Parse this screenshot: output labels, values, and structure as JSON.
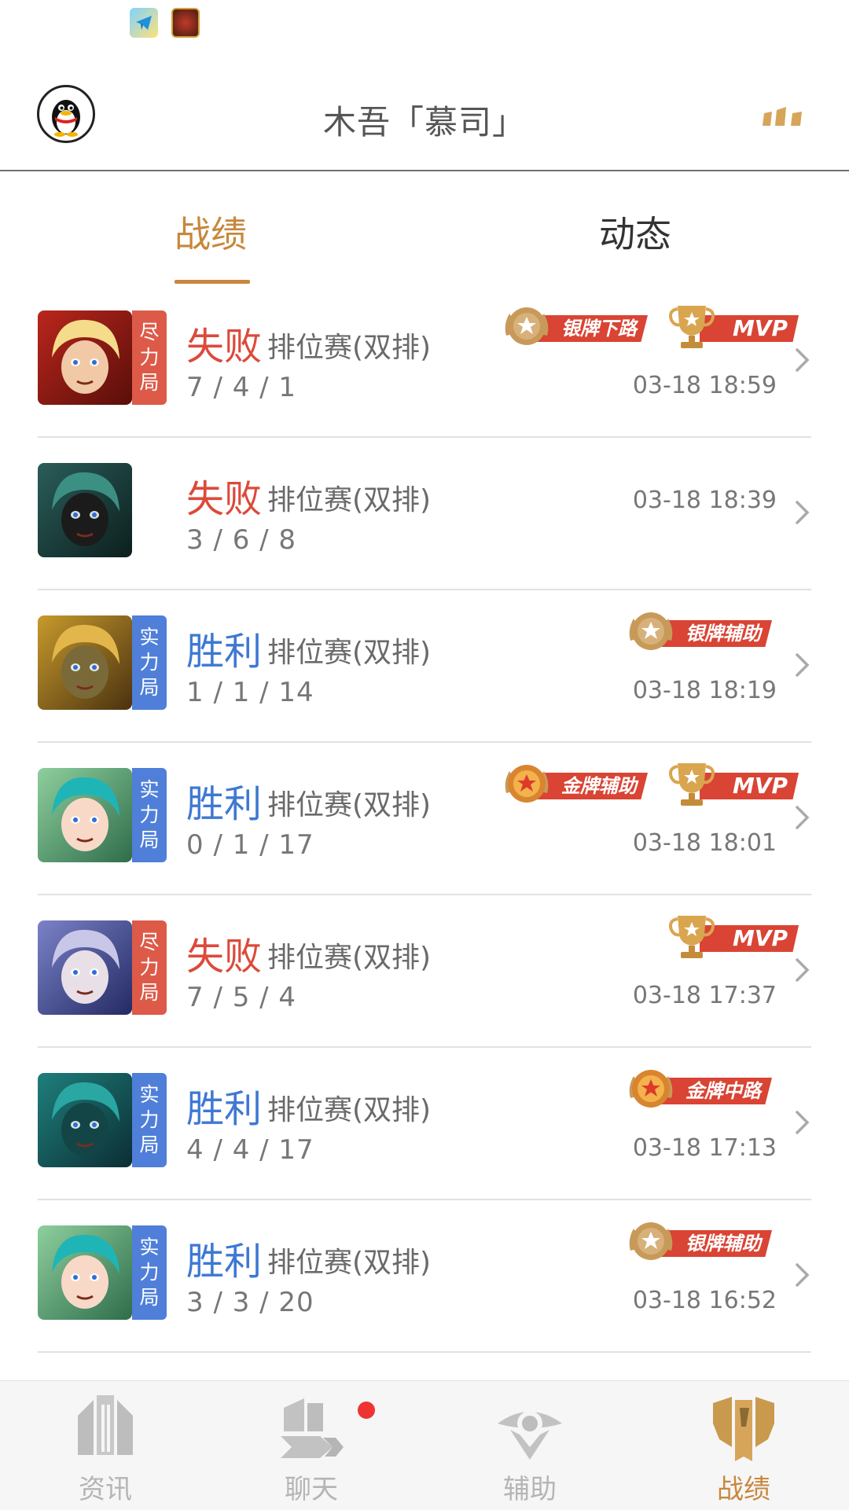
{
  "header": {
    "title": "木吾「慕司」"
  },
  "tabs": [
    {
      "label": "战绩",
      "active": true
    },
    {
      "label": "动态",
      "active": false
    }
  ],
  "matches": [
    {
      "result": "失败",
      "outcome": "lose",
      "type": "排位赛(双排)",
      "kda": "7 / 4 / 1",
      "time": "03-18 18:59",
      "mode": [
        "尽",
        "力",
        "局"
      ],
      "mode_color": "red",
      "badges": [
        "银牌下路",
        "MVP"
      ],
      "hero_icon": "hero-blonde-warrior"
    },
    {
      "result": "失败",
      "outcome": "lose",
      "type": "排位赛(双排)",
      "kda": "3 / 6 / 8",
      "time": "03-18 18:39",
      "mode": [],
      "mode_color": "none",
      "badges": [],
      "hero_icon": "hero-hooded-goblin"
    },
    {
      "result": "胜利",
      "outcome": "win",
      "type": "排位赛(双排)",
      "kda": "1 / 1 / 14",
      "time": "03-18 18:19",
      "mode": [
        "实",
        "力",
        "局"
      ],
      "mode_color": "blue",
      "badges": [
        "银牌辅助"
      ],
      "hero_icon": "hero-golden-beast"
    },
    {
      "result": "胜利",
      "outcome": "win",
      "type": "排位赛(双排)",
      "kda": "0 / 1 / 17",
      "time": "03-18 18:01",
      "mode": [
        "实",
        "力",
        "局"
      ],
      "mode_color": "blue",
      "badges": [
        "金牌辅助",
        "MVP"
      ],
      "hero_icon": "hero-teal-girl"
    },
    {
      "result": "失败",
      "outcome": "lose",
      "type": "排位赛(双排)",
      "kda": "7 / 5 / 4",
      "time": "03-18 17:37",
      "mode": [
        "尽",
        "力",
        "局"
      ],
      "mode_color": "red",
      "badges": [
        "MVP"
      ],
      "hero_icon": "hero-silver-elf"
    },
    {
      "result": "胜利",
      "outcome": "win",
      "type": "排位赛(双排)",
      "kda": "4 / 4 / 17",
      "time": "03-18 17:13",
      "mode": [
        "实",
        "力",
        "局"
      ],
      "mode_color": "blue",
      "badges": [
        "金牌中路"
      ],
      "hero_icon": "hero-mech-knight"
    },
    {
      "result": "胜利",
      "outcome": "win",
      "type": "排位赛(双排)",
      "kda": "3 / 3 / 20",
      "time": "03-18 16:52",
      "mode": [
        "实",
        "力",
        "局"
      ],
      "mode_color": "blue",
      "badges": [
        "银牌辅助"
      ],
      "hero_icon": "hero-teal-girl"
    }
  ],
  "nav": [
    {
      "label": "资讯",
      "icon": "news-building-icon",
      "active": false
    },
    {
      "label": "聊天",
      "icon": "chat-icon",
      "active": false,
      "notification": true
    },
    {
      "label": "辅助",
      "icon": "assist-eye-icon",
      "active": false
    },
    {
      "label": "战绩",
      "icon": "record-shield-icon",
      "active": true
    }
  ],
  "colors": {
    "accent": "#c8873c",
    "lose": "#dc4a3a",
    "win": "#3e78d3",
    "tag_red": "#dd5a49",
    "tag_blue": "#4f7fd8"
  }
}
